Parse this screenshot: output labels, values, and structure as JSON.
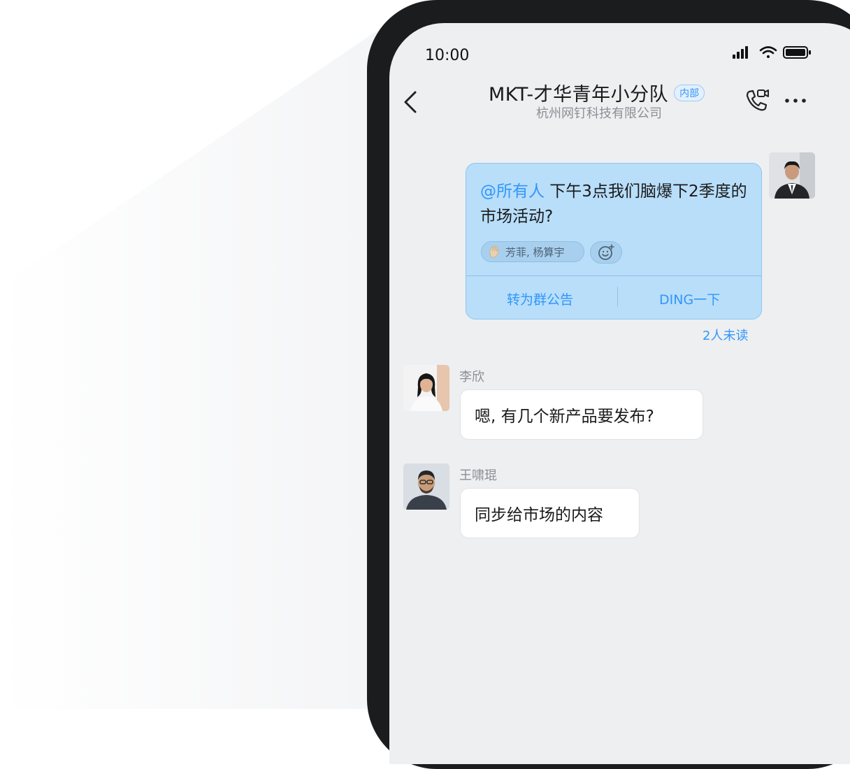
{
  "status_bar": {
    "time": "10:00"
  },
  "header": {
    "title": "MKT-才华青年小分队",
    "badge": "内部",
    "subtitle": "杭州网钉科技有限公司"
  },
  "messages": {
    "mine": {
      "mention": "@所有人",
      "text": " 下午3点我们脑爆下2季度的市场活动?",
      "reactions": "芳菲, 杨算宇",
      "actions": {
        "announce": "转为群公告",
        "ding": "DING一下"
      },
      "unread": "2人未读"
    },
    "lixin": {
      "sender": "李欣",
      "text": "嗯, 有几个新产品要发布?"
    },
    "wang": {
      "sender": "王啸琨",
      "text": "同步给市场的内容"
    }
  },
  "colors": {
    "accent": "#3296fa",
    "bubble_blue": "#b8defa",
    "screen_bg": "#edeff1",
    "frame": "#1b1c1e"
  },
  "icons": [
    "signal-icon",
    "wifi-icon",
    "battery-icon",
    "back-arrow-icon",
    "video-call-icon",
    "more-icon",
    "clap-icon",
    "add-emoji-icon"
  ]
}
